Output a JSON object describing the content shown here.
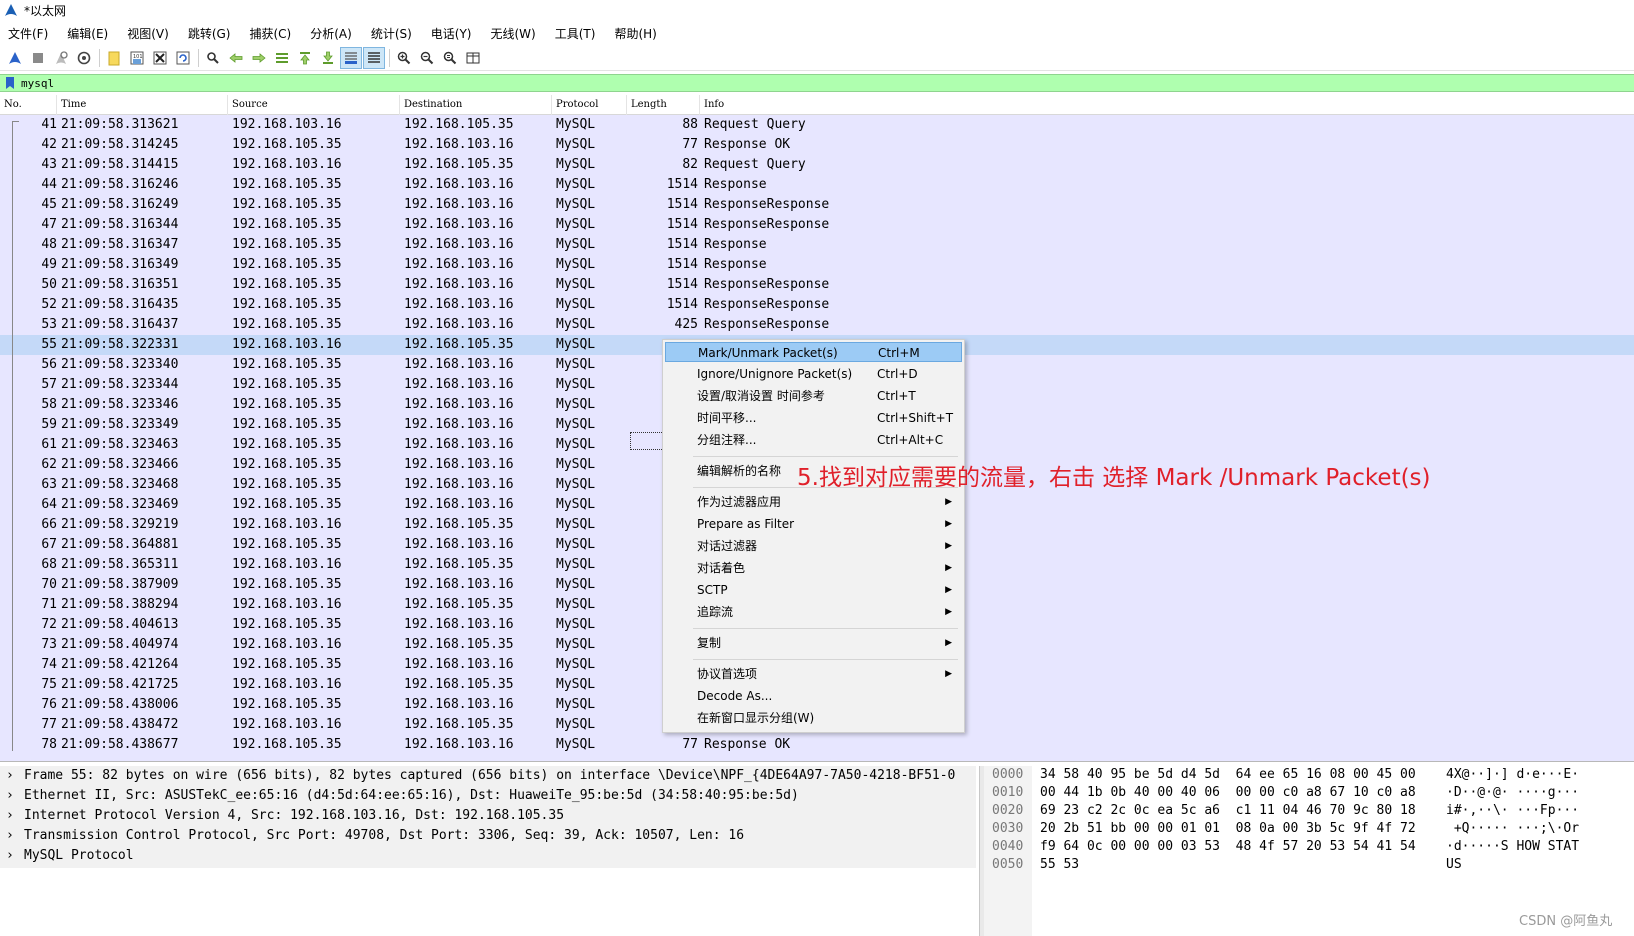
{
  "window": {
    "title": "*以太网"
  },
  "menu": [
    "文件(F)",
    "编辑(E)",
    "视图(V)",
    "跳转(G)",
    "捕获(C)",
    "分析(A)",
    "统计(S)",
    "电话(Y)",
    "无线(W)",
    "工具(T)",
    "帮助(H)"
  ],
  "toolbar": {
    "icons": [
      "shark-fin-start-icon",
      "stop-square-icon",
      "restart-fin-icon",
      "capture-options-gear-icon",
      "open-folder-icon",
      "save-file-icon",
      "close-file-icon",
      "reload-icon",
      "find-magnifier-icon",
      "go-back-arrow-icon",
      "go-forward-arrow-icon",
      "go-to-packet-icon",
      "go-first-packet-icon",
      "go-last-packet-icon",
      "autoscroll-icon",
      "colorize-icon",
      "zoom-in-icon",
      "zoom-out-icon",
      "zoom-normal-icon",
      "resize-columns-icon"
    ]
  },
  "filter": {
    "value": "mysql"
  },
  "columns": {
    "no": "No.",
    "time": "Time",
    "source": "Source",
    "destination": "Destination",
    "protocol": "Protocol",
    "length": "Length",
    "info": "Info"
  },
  "packets": [
    {
      "no": "41",
      "time": "21:09:58.313621",
      "src": "192.168.103.16",
      "dst": "192.168.105.35",
      "proto": "MySQL",
      "len": "88",
      "info": "Request Query"
    },
    {
      "no": "42",
      "time": "21:09:58.314245",
      "src": "192.168.105.35",
      "dst": "192.168.103.16",
      "proto": "MySQL",
      "len": "77",
      "info": "Response OK"
    },
    {
      "no": "43",
      "time": "21:09:58.314415",
      "src": "192.168.103.16",
      "dst": "192.168.105.35",
      "proto": "MySQL",
      "len": "82",
      "info": "Request Query"
    },
    {
      "no": "44",
      "time": "21:09:58.316246",
      "src": "192.168.105.35",
      "dst": "192.168.103.16",
      "proto": "MySQL",
      "len": "1514",
      "info": "Response"
    },
    {
      "no": "45",
      "time": "21:09:58.316249",
      "src": "192.168.105.35",
      "dst": "192.168.103.16",
      "proto": "MySQL",
      "len": "1514",
      "info": "ResponseResponse"
    },
    {
      "no": "47",
      "time": "21:09:58.316344",
      "src": "192.168.105.35",
      "dst": "192.168.103.16",
      "proto": "MySQL",
      "len": "1514",
      "info": "ResponseResponse"
    },
    {
      "no": "48",
      "time": "21:09:58.316347",
      "src": "192.168.105.35",
      "dst": "192.168.103.16",
      "proto": "MySQL",
      "len": "1514",
      "info": "Response"
    },
    {
      "no": "49",
      "time": "21:09:58.316349",
      "src": "192.168.105.35",
      "dst": "192.168.103.16",
      "proto": "MySQL",
      "len": "1514",
      "info": "Response"
    },
    {
      "no": "50",
      "time": "21:09:58.316351",
      "src": "192.168.105.35",
      "dst": "192.168.103.16",
      "proto": "MySQL",
      "len": "1514",
      "info": "ResponseResponse"
    },
    {
      "no": "52",
      "time": "21:09:58.316435",
      "src": "192.168.105.35",
      "dst": "192.168.103.16",
      "proto": "MySQL",
      "len": "1514",
      "info": "ResponseResponse"
    },
    {
      "no": "53",
      "time": "21:09:58.316437",
      "src": "192.168.105.35",
      "dst": "192.168.103.16",
      "proto": "MySQL",
      "len": "425",
      "info": "ResponseResponse"
    },
    {
      "no": "55",
      "time": "21:09:58.322331",
      "src": "192.168.103.16",
      "dst": "192.168.105.35",
      "proto": "MySQL",
      "len": "",
      "info": "",
      "selected": true
    },
    {
      "no": "56",
      "time": "21:09:58.323340",
      "src": "192.168.105.35",
      "dst": "192.168.103.16",
      "proto": "MySQL",
      "len": "",
      "info": ""
    },
    {
      "no": "57",
      "time": "21:09:58.323344",
      "src": "192.168.105.35",
      "dst": "192.168.103.16",
      "proto": "MySQL",
      "len": "",
      "info": ""
    },
    {
      "no": "58",
      "time": "21:09:58.323346",
      "src": "192.168.105.35",
      "dst": "192.168.103.16",
      "proto": "MySQL",
      "len": "",
      "info": ""
    },
    {
      "no": "59",
      "time": "21:09:58.323349",
      "src": "192.168.105.35",
      "dst": "192.168.103.16",
      "proto": "MySQL",
      "len": "",
      "info": ""
    },
    {
      "no": "61",
      "time": "21:09:58.323463",
      "src": "192.168.105.35",
      "dst": "192.168.103.16",
      "proto": "MySQL",
      "len": "",
      "info": ""
    },
    {
      "no": "62",
      "time": "21:09:58.323466",
      "src": "192.168.105.35",
      "dst": "192.168.103.16",
      "proto": "MySQL",
      "len": "",
      "info": ""
    },
    {
      "no": "63",
      "time": "21:09:58.323468",
      "src": "192.168.105.35",
      "dst": "192.168.103.16",
      "proto": "MySQL",
      "len": "",
      "info": ""
    },
    {
      "no": "64",
      "time": "21:09:58.323469",
      "src": "192.168.105.35",
      "dst": "192.168.103.16",
      "proto": "MySQL",
      "len": "",
      "info": ""
    },
    {
      "no": "66",
      "time": "21:09:58.329219",
      "src": "192.168.103.16",
      "dst": "192.168.105.35",
      "proto": "MySQL",
      "len": "",
      "info": ""
    },
    {
      "no": "67",
      "time": "21:09:58.364881",
      "src": "192.168.105.35",
      "dst": "192.168.103.16",
      "proto": "MySQL",
      "len": "",
      "info": ""
    },
    {
      "no": "68",
      "time": "21:09:58.365311",
      "src": "192.168.103.16",
      "dst": "192.168.105.35",
      "proto": "MySQL",
      "len": "",
      "info": ""
    },
    {
      "no": "70",
      "time": "21:09:58.387909",
      "src": "192.168.105.35",
      "dst": "192.168.103.16",
      "proto": "MySQL",
      "len": "",
      "info": ""
    },
    {
      "no": "71",
      "time": "21:09:58.388294",
      "src": "192.168.103.16",
      "dst": "192.168.105.35",
      "proto": "MySQL",
      "len": "",
      "info": ""
    },
    {
      "no": "72",
      "time": "21:09:58.404613",
      "src": "192.168.105.35",
      "dst": "192.168.103.16",
      "proto": "MySQL",
      "len": "",
      "info": ""
    },
    {
      "no": "73",
      "time": "21:09:58.404974",
      "src": "192.168.103.16",
      "dst": "192.168.105.35",
      "proto": "MySQL",
      "len": "",
      "info": ""
    },
    {
      "no": "74",
      "time": "21:09:58.421264",
      "src": "192.168.105.35",
      "dst": "192.168.103.16",
      "proto": "MySQL",
      "len": "",
      "info": ""
    },
    {
      "no": "75",
      "time": "21:09:58.421725",
      "src": "192.168.103.16",
      "dst": "192.168.105.35",
      "proto": "MySQL",
      "len": "",
      "info": ""
    },
    {
      "no": "76",
      "time": "21:09:58.438006",
      "src": "192.168.105.35",
      "dst": "192.168.103.16",
      "proto": "MySQL",
      "len": "",
      "info": ""
    },
    {
      "no": "77",
      "time": "21:09:58.438472",
      "src": "192.168.103.16",
      "dst": "192.168.105.35",
      "proto": "MySQL",
      "len": "",
      "info": ""
    },
    {
      "no": "78",
      "time": "21:09:58.438677",
      "src": "192.168.105.35",
      "dst": "192.168.103.16",
      "proto": "MySQL",
      "len": "77",
      "info": "Response OK"
    }
  ],
  "context_menu": [
    {
      "label": "Mark/Unmark Packet(s)",
      "shortcut": "Ctrl+M",
      "highlighted": true
    },
    {
      "label": "Ignore/Unignore Packet(s)",
      "shortcut": "Ctrl+D"
    },
    {
      "label": "设置/取消设置 时间参考",
      "shortcut": "Ctrl+T"
    },
    {
      "label": "时间平移...",
      "shortcut": "Ctrl+Shift+T"
    },
    {
      "label": "分组注释...",
      "shortcut": "Ctrl+Alt+C"
    },
    {
      "separator": true
    },
    {
      "label": "编辑解析的名称",
      "shortcut": ""
    },
    {
      "separator": true
    },
    {
      "label": "作为过滤器应用",
      "submenu": true
    },
    {
      "label": "Prepare as Filter",
      "submenu": true
    },
    {
      "label": "对话过滤器",
      "submenu": true
    },
    {
      "label": "对话着色",
      "submenu": true
    },
    {
      "label": "SCTP",
      "submenu": true
    },
    {
      "label": "追踪流",
      "submenu": true
    },
    {
      "separator": true
    },
    {
      "label": "复制",
      "submenu": true
    },
    {
      "separator": true
    },
    {
      "label": "协议首选项",
      "submenu": true
    },
    {
      "label": "Decode As..."
    },
    {
      "label": "在新窗口显示分组(W)"
    }
  ],
  "annotation": "5.找到对应需要的流量，右击 选择  Mark /Unmark Packet(s)",
  "annotation_color": "#e0202a",
  "details": [
    "Frame 55: 82 bytes on wire (656 bits), 82 bytes captured (656 bits) on interface \\Device\\NPF_{4DE64A97-7A50-4218-BF51-0",
    "Ethernet II, Src: ASUSTekC_ee:65:16 (d4:5d:64:ee:65:16), Dst: HuaweiTe_95:be:5d (34:58:40:95:be:5d)",
    "Internet Protocol Version 4, Src: 192.168.103.16, Dst: 192.168.105.35",
    "Transmission Control Protocol, Src Port: 49708, Dst Port: 3306, Seq: 39, Ack: 10507, Len: 16",
    "MySQL Protocol"
  ],
  "hex": [
    {
      "off": "0000",
      "bytes": "34 58 40 95 be 5d d4 5d  64 ee 65 16 08 00 45 00",
      "ascii": "4X@··]·] d·e···E·"
    },
    {
      "off": "0010",
      "bytes": "00 44 1b 0b 40 00 40 06  00 00 c0 a8 67 10 c0 a8",
      "ascii": "·D··@·@· ····g···"
    },
    {
      "off": "0020",
      "bytes": "69 23 c2 2c 0c ea 5c a6  c1 11 04 46 70 9c 80 18",
      "ascii": "i#·,··\\· ···Fp···"
    },
    {
      "off": "0030",
      "bytes": "20 2b 51 bb 00 00 01 01  08 0a 00 3b 5c 9f 4f 72",
      "ascii": " +Q····· ···;\\·Or"
    },
    {
      "off": "0040",
      "bytes": "f9 64 0c 00 00 00 03 53  48 4f 57 20 53 54 41 54",
      "ascii": "·d·····S HOW STAT"
    },
    {
      "off": "0050",
      "bytes": "55 53",
      "ascii": "US"
    }
  ],
  "watermark": "CSDN @阿鱼丸",
  "colors": {
    "filter_bg": "#afffaf",
    "row_bg": "#e7e6ff",
    "selected_row": "#c4d9f8",
    "menu_highlight": "#9ccbf5"
  }
}
